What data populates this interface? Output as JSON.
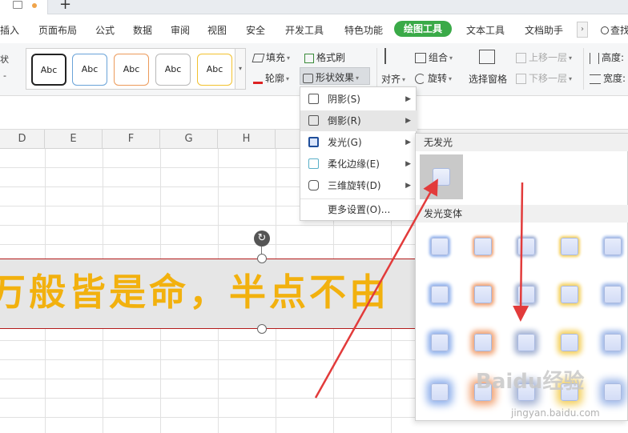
{
  "menu": {
    "items": [
      "插入",
      "页面布局",
      "公式",
      "数据",
      "审阅",
      "视图",
      "安全",
      "开发工具",
      "特色功能",
      "绘图工具",
      "文本工具",
      "文档助手"
    ],
    "active": "绘图工具",
    "search_fragment": "查找"
  },
  "ribbon": {
    "left_fragments": [
      "状",
      "-"
    ],
    "style_label": "Abc",
    "fill": "填充",
    "format_painter": "格式刷",
    "outline": "轮廓",
    "shape_effects": "形状效果",
    "align": "对齐",
    "group": "组合",
    "rotate": "旋转",
    "selection_pane": "选择窗格",
    "bring_forward": "上移一层",
    "send_backward": "下移一层",
    "height_fragment": "高度:",
    "width_fragment": "宽度:"
  },
  "columns": [
    "D",
    "E",
    "F",
    "G",
    "H"
  ],
  "shape": {
    "text": "万般皆是命，半点不由"
  },
  "dropdown": {
    "items": [
      {
        "label": "阴影(S)",
        "icon": "shadow-icon",
        "has_submenu": true
      },
      {
        "label": "倒影(R)",
        "icon": "reflection-icon",
        "has_submenu": true
      },
      {
        "label": "发光(G)",
        "icon": "glow-icon",
        "has_submenu": true
      },
      {
        "label": "柔化边缘(E)",
        "icon": "soft-edge-icon",
        "has_submenu": true
      },
      {
        "label": "三维旋转(D)",
        "icon": "3d-rotation-icon",
        "has_submenu": true
      }
    ],
    "more": "更多设置(O)..."
  },
  "glow_submenu": {
    "no_glow": "无发光",
    "variants": "发光变体"
  },
  "watermark": {
    "brand": "Baidu经验",
    "url": "jingyan.baidu.com"
  },
  "colors": {
    "accent_green": "#3aaa48",
    "shape_text": "#f2b10e",
    "annotation_red": "#e23b3b",
    "glow_variants": [
      "#8fb0ec",
      "#f0a070",
      "#a6b4d4",
      "#f4cf5a",
      "#9fb8e8"
    ]
  }
}
